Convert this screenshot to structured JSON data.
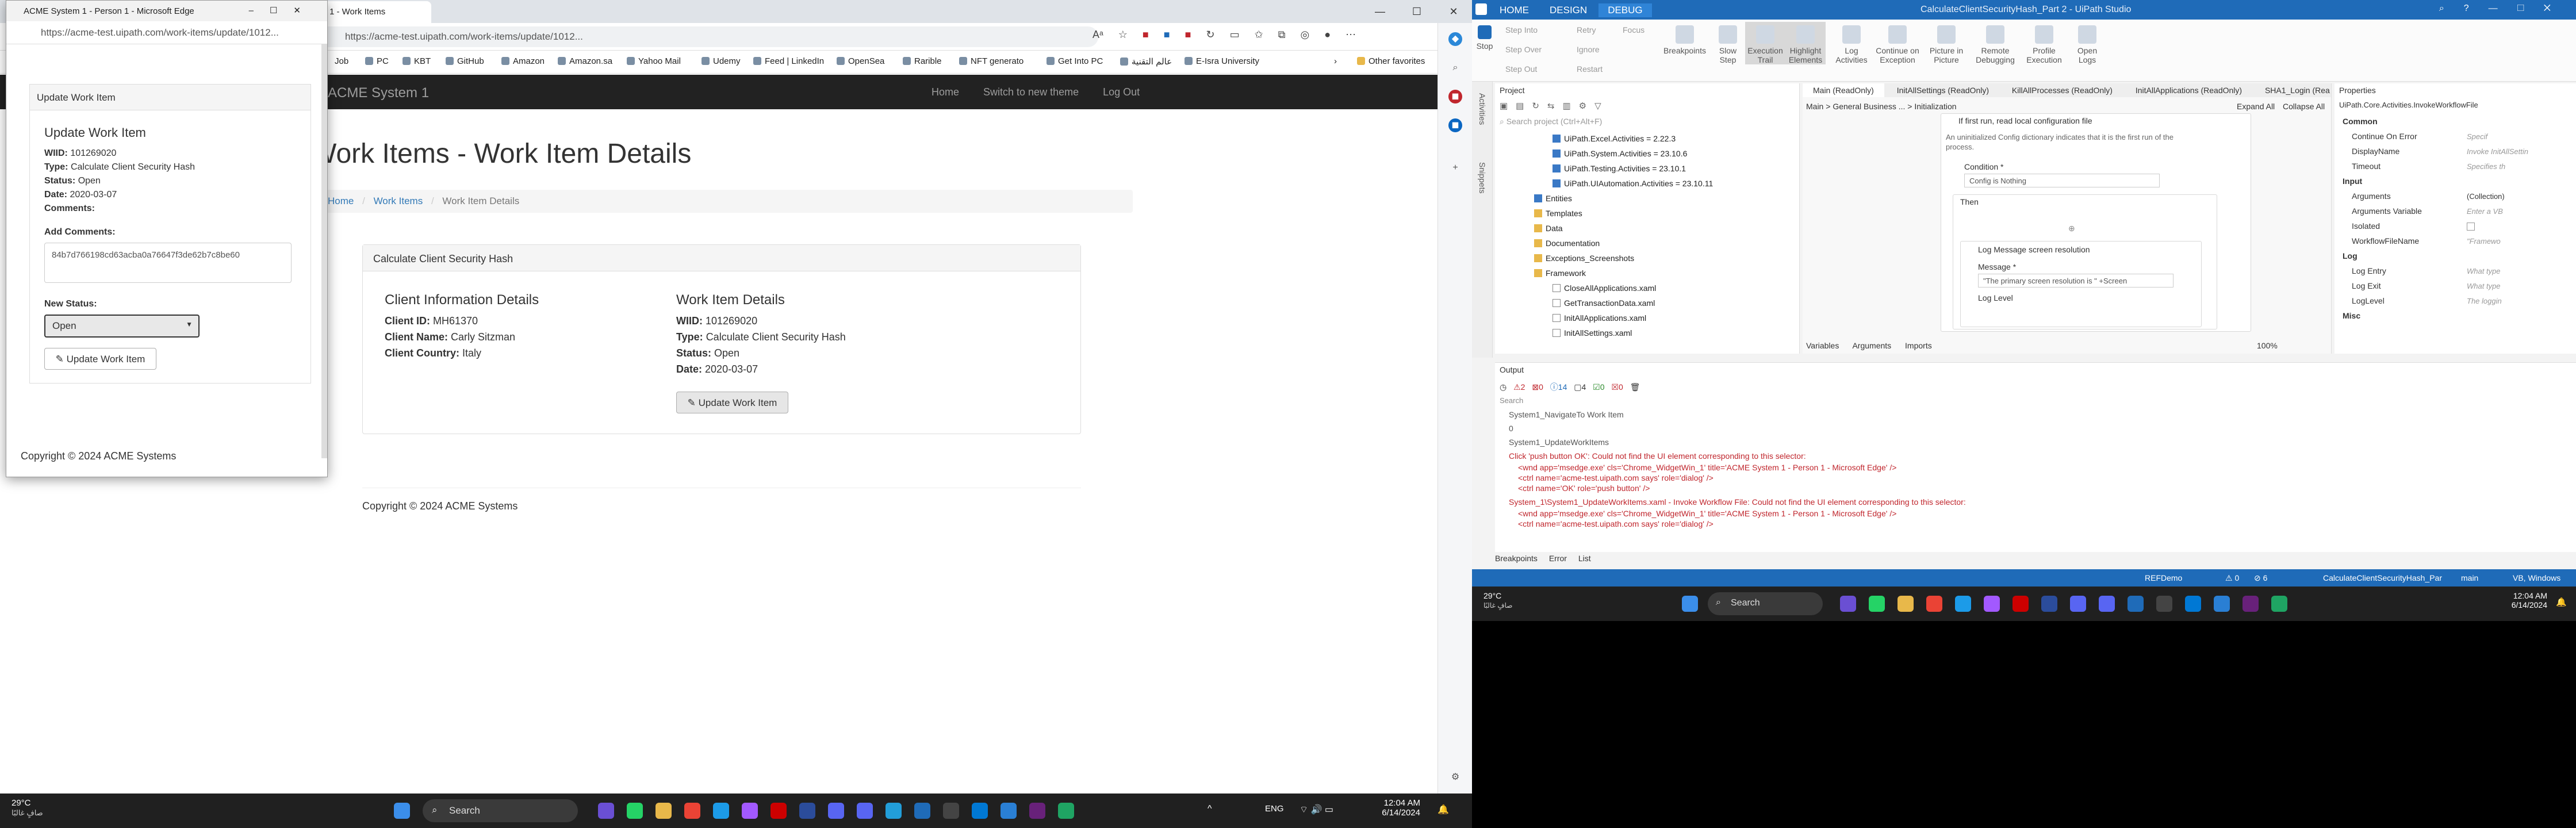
{
  "browser": {
    "tab_title": "1 - Work Items",
    "url": "https://acme-test.uipath.com/work-items/update/1012...",
    "bookmarks": [
      "Job",
      "PC",
      "KBT",
      "GitHub",
      "Amazon",
      "Amazon.sa",
      "Yahoo Mail",
      "Udemy",
      "Feed | LinkedIn",
      "OpenSea",
      "Rarible",
      "NFT generato",
      "Get Into PC",
      "عالم التقنية",
      "E-Isra University",
      "Other favorites"
    ]
  },
  "site": {
    "brand": "ACME System 1",
    "nav": [
      "Home",
      "Switch to new theme",
      "Log Out"
    ],
    "title": "Work Items - Work Item Details",
    "breadcrumb": [
      "Home",
      "Work Items",
      "Work Item Details"
    ],
    "panel_title": "Calculate Client Security Hash",
    "client_section": "Client Information Details",
    "client": {
      "id_label": "Client ID:",
      "id": "MH61370",
      "name_label": "Client Name:",
      "name": "Carly Sitzman",
      "country_label": "Client Country:",
      "country": "Italy"
    },
    "work_section": "Work Item Details",
    "work": {
      "wiid_label": "WIID:",
      "wiid": "101269020",
      "type_label": "Type:",
      "type": "Calculate Client Security Hash",
      "status_label": "Status:",
      "status": "Open",
      "date_label": "Date:",
      "date": "2020-03-07"
    },
    "update_button": "Update Work Item",
    "footer": "Copyright © 2024 ACME Systems"
  },
  "popup": {
    "window_title": "ACME System 1 - Person 1 - Microsoft Edge",
    "url": "https://acme-test.uipath.com/work-items/update/1012...",
    "header": "Update Work Item",
    "heading": "Update Work Item",
    "wiid": "101269020",
    "type": "Calculate Client Security Hash",
    "status": "Open",
    "date": "2020-03-07",
    "comments_label": "Comments:",
    "add_comments_label": "Add Comments:",
    "comment_value": "84b7d766198cd63acba0a76647f3de62b7c8be60",
    "new_status_label": "New Status:",
    "status_selected": "Open",
    "button": "Update Work Item",
    "footer": "Copyright © 2024 ACME Systems"
  },
  "taskbar_left": {
    "weather_temp": "29°C",
    "weather_desc": "صافٍ غالبًا",
    "search": "Search",
    "lang": "ENG",
    "time": "12:04 AM",
    "date": "6/14/2024"
  },
  "uipath": {
    "tabs": [
      "HOME",
      "DESIGN",
      "DEBUG"
    ],
    "window_title": "CalculateClientSecurityHash_Part 2 - UiPath Studio",
    "ribbon": [
      "Stop",
      "Step Into",
      "Step Over",
      "Step Out",
      "Retry",
      "Ignore",
      "Restart",
      "Focus",
      "Breakpoints",
      "Slow Step",
      "Execution Trail",
      "Highlight Elements",
      "Log Activities",
      "Continue on Exception",
      "Picture in Picture",
      "Remote Debugging",
      "Profile Execution",
      "Open Logs"
    ],
    "project_label": "Project",
    "search_placeholder": "Search project (Ctrl+Alt+F)",
    "tree": [
      "UiPath.Excel.Activities = 2.22.3",
      "UiPath.System.Activities = 23.10.6",
      "UiPath.Testing.Activities = 23.10.1",
      "UiPath.UIAutomation.Activities = 23.10.11",
      "Entities",
      "Templates",
      "Data",
      "Documentation",
      "Exceptions_Screenshots",
      "Framework",
      "CloseAllApplications.xaml",
      "GetTransactionData.xaml",
      "InitAllApplications.xaml",
      "InitAllSettings.xaml"
    ],
    "doc_tabs": [
      "Main (ReadOnly)",
      "InitAllSettings (ReadOnly)",
      "KillAllProcesses (ReadOnly)",
      "InitAllApplications (ReadOnly)",
      "SHA1_Login (Rea"
    ],
    "design_bc": [
      "Main",
      "General Business ...",
      "Initialization"
    ],
    "expand": "Expand All",
    "collapse": "Collapse All",
    "if_title": "If first run, read local configuration file",
    "if_desc": "An uninitialized Config dictionary indicates that it is the first run of the process.",
    "condition_label": "Condition *",
    "condition_value": "Config is Nothing",
    "then_label": "Then",
    "log_title": "Log Message screen resolution",
    "message_label": "Message *",
    "message_value": "\"The primary screen resolution is \" +Screen",
    "log_level": "Log Level",
    "bottom_tabs": [
      "Variables",
      "Arguments",
      "Imports"
    ],
    "zoom": "100%",
    "props_label": "Properties",
    "props_type": "UiPath.Core.Activities.InvokeWorkflowFile",
    "props": [
      {
        "k": "Common",
        "v": "",
        "h": true
      },
      {
        "k": "Continue On Error",
        "v": "Specif"
      },
      {
        "k": "DisplayName",
        "v": "Invoke InitAllSettin"
      },
      {
        "k": "Timeout",
        "v": "Specifies th"
      },
      {
        "k": "Input",
        "v": "",
        "h": true
      },
      {
        "k": "Arguments",
        "v": "(Collection)"
      },
      {
        "k": "Arguments Variable",
        "v": "Enter a VB"
      },
      {
        "k": "Isolated",
        "v": ""
      },
      {
        "k": "WorkflowFileName",
        "v": "\"Framewo"
      },
      {
        "k": "Log",
        "v": "",
        "h": true
      },
      {
        "k": "Log Entry",
        "v": "What type"
      },
      {
        "k": "Log Exit",
        "v": "What type"
      },
      {
        "k": "LogLevel",
        "v": "The loggin"
      },
      {
        "k": "Misc",
        "v": "",
        "h": true
      }
    ],
    "output_label": "Output",
    "output_counts": [
      "2",
      "0",
      "14",
      "4",
      "0",
      "0"
    ],
    "output_search": "Search",
    "output_lines": [
      {
        "t": "System1_NavigateTo Work Item",
        "e": false
      },
      {
        "t": "0",
        "e": false
      },
      {
        "t": "System1_UpdateWorkItems",
        "e": false
      },
      {
        "t": "Click 'push button  OK': Could not find the UI element corresponding to this selector:",
        "e": true
      },
      {
        "t": "<wnd app='msedge.exe' cls='Chrome_WidgetWin_1' title='ACME System 1 - Person 1 - Microsoft Edge' />",
        "e": true
      },
      {
        "t": "<ctrl name='acme-test.uipath.com says' role='dialog' />",
        "e": true
      },
      {
        "t": "<ctrl name='OK' role='push button' />",
        "e": true
      },
      {
        "t": "System_1\\System1_UpdateWorkItems.xaml - Invoke Workflow File: Could not find the UI element corresponding to this selector:",
        "e": true
      },
      {
        "t": "<wnd app='msedge.exe' cls='Chrome_WidgetWin_1' title='ACME System 1 - Person 1 - Microsoft Edge' />",
        "e": true
      },
      {
        "t": "<ctrl name='acme-test.uipath.com says' role='dialog' />",
        "e": true
      }
    ],
    "bottom_panel_tabs": [
      "Breakpoints",
      "Error List"
    ],
    "status": {
      "repo": "REFDemo",
      "warn": "0",
      "err": "6",
      "file": "CalculateClientSecurityHash_Par",
      "branch": "main",
      "lang": "VB, Windows"
    }
  },
  "taskbar_right": {
    "weather_temp": "29°C",
    "weather_desc": "صافٍ غالبًا",
    "search": "Search",
    "time": "12:04 AM",
    "date": "6/14/2024"
  },
  "colors": {
    "uipath_blue": "#1f6bb8",
    "error_red": "#c0262d",
    "navbar": "#222222",
    "link": "#337ab7"
  }
}
